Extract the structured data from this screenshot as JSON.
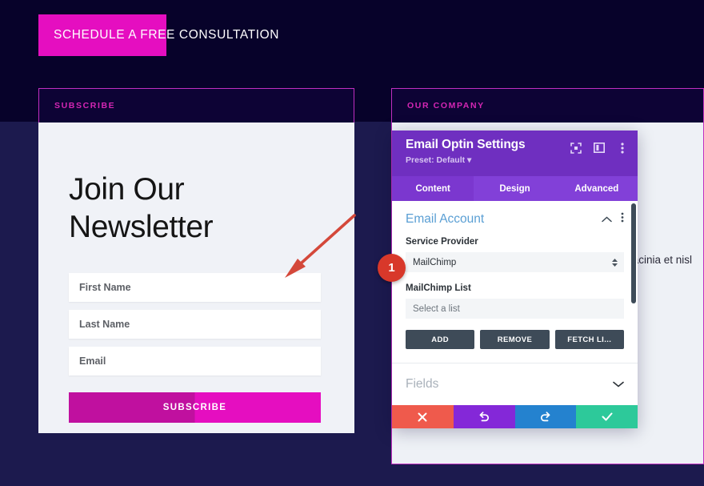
{
  "theme": {
    "page_bg_top": "#07022a",
    "page_bg_bottom": "#1c1a4e",
    "accent_magenta": "#e50ec0",
    "card_border": "#c02ec0",
    "modal_purple": "#6f2fc0",
    "badge_red": "#d8382a",
    "arrow_red": "#d4483a"
  },
  "cta": {
    "label": "SCHEDULE A FREE CONSULTATION"
  },
  "left_card": {
    "eyebrow": "SUBSCRIBE",
    "title": "Join Our Newsletter",
    "fields": [
      {
        "name": "first-name",
        "placeholder": "First Name",
        "value": ""
      },
      {
        "name": "last-name",
        "placeholder": "Last Name",
        "value": ""
      },
      {
        "name": "email",
        "placeholder": "Email",
        "value": ""
      }
    ],
    "submit_label": "SUBSCRIBE"
  },
  "right_card": {
    "eyebrow": "OUR COMPANY",
    "body_text": "id dui nia in, lacinia et nisl"
  },
  "modal": {
    "title": "Email Optin Settings",
    "preset": "Preset: Default",
    "titlebar_icons": [
      {
        "name": "fullscreen-icon"
      },
      {
        "name": "layout-columns-icon"
      },
      {
        "name": "more-vertical-icon"
      }
    ],
    "tabs": [
      {
        "label": "Content",
        "active": true
      },
      {
        "label": "Design",
        "active": false
      },
      {
        "label": "Advanced",
        "active": false
      }
    ],
    "open_section": {
      "title": "Email Account",
      "collapse_icon": "chevron-up-icon",
      "menu_icon": "more-vertical-icon",
      "service_provider": {
        "label": "Service Provider",
        "value": "MailChimp"
      },
      "mailchimp_list": {
        "label": "MailChimp List",
        "placeholder": "Select a list",
        "value": ""
      },
      "buttons": [
        {
          "label": "ADD",
          "name": "add-account-button"
        },
        {
          "label": "REMOVE",
          "name": "remove-account-button"
        },
        {
          "label": "FETCH LI...",
          "name": "fetch-lists-button"
        }
      ]
    },
    "closed_section": {
      "title": "Fields",
      "expand_icon": "chevron-down-icon"
    },
    "footer_buttons": [
      {
        "name": "cancel-button",
        "icon": "close-icon",
        "color": "#ef5a4c"
      },
      {
        "name": "undo-button",
        "icon": "undo-icon",
        "color": "#8428d8"
      },
      {
        "name": "redo-button",
        "icon": "redo-icon",
        "color": "#2482cf"
      },
      {
        "name": "save-button",
        "icon": "check-icon",
        "color": "#2dc99a"
      }
    ]
  },
  "annotations": {
    "step_badge": "1",
    "arrow": "diagonal-arrow-pointing-down-left"
  }
}
